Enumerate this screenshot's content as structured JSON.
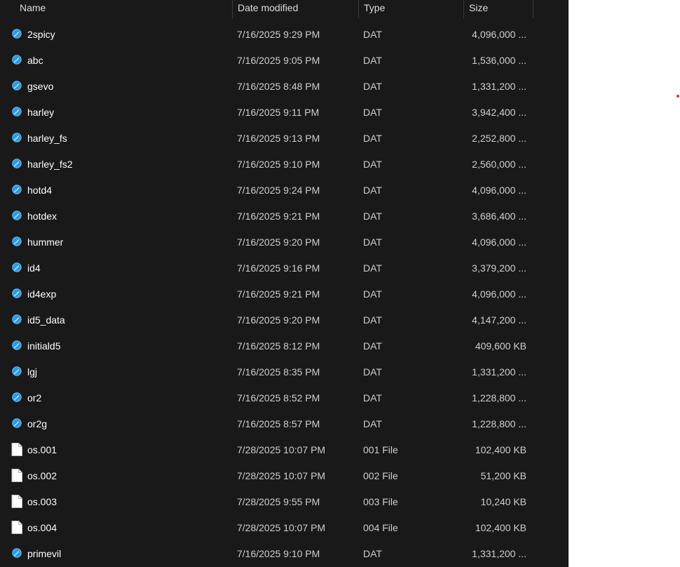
{
  "columns": {
    "name": "Name",
    "date": "Date modified",
    "type": "Type",
    "size": "Size"
  },
  "files": [
    {
      "name": "2spicy",
      "date": "7/16/2025 9:29 PM",
      "type": "DAT",
      "size": "4,096,000 ...",
      "icon": "dat-icon"
    },
    {
      "name": "abc",
      "date": "7/16/2025 9:05 PM",
      "type": "DAT",
      "size": "1,536,000 ...",
      "icon": "dat-icon"
    },
    {
      "name": "gsevo",
      "date": "7/16/2025 8:48 PM",
      "type": "DAT",
      "size": "1,331,200 ...",
      "icon": "dat-icon"
    },
    {
      "name": "harley",
      "date": "7/16/2025 9:11 PM",
      "type": "DAT",
      "size": "3,942,400 ...",
      "icon": "dat-icon"
    },
    {
      "name": "harley_fs",
      "date": "7/16/2025 9:13 PM",
      "type": "DAT",
      "size": "2,252,800 ...",
      "icon": "dat-icon"
    },
    {
      "name": "harley_fs2",
      "date": "7/16/2025 9:10 PM",
      "type": "DAT",
      "size": "2,560,000 ...",
      "icon": "dat-icon"
    },
    {
      "name": "hotd4",
      "date": "7/16/2025 9:24 PM",
      "type": "DAT",
      "size": "4,096,000 ...",
      "icon": "dat-icon"
    },
    {
      "name": "hotdex",
      "date": "7/16/2025 9:21 PM",
      "type": "DAT",
      "size": "3,686,400 ...",
      "icon": "dat-icon"
    },
    {
      "name": "hummer",
      "date": "7/16/2025 9:20 PM",
      "type": "DAT",
      "size": "4,096,000 ...",
      "icon": "dat-icon"
    },
    {
      "name": "id4",
      "date": "7/16/2025 9:16 PM",
      "type": "DAT",
      "size": "3,379,200 ...",
      "icon": "dat-icon"
    },
    {
      "name": "id4exp",
      "date": "7/16/2025 9:21 PM",
      "type": "DAT",
      "size": "4,096,000 ...",
      "icon": "dat-icon"
    },
    {
      "name": "id5_data",
      "date": "7/16/2025 9:20 PM",
      "type": "DAT",
      "size": "4,147,200 ...",
      "icon": "dat-icon"
    },
    {
      "name": "initiald5",
      "date": "7/16/2025 8:12 PM",
      "type": "DAT",
      "size": "409,600 KB",
      "icon": "dat-icon"
    },
    {
      "name": "lgj",
      "date": "7/16/2025 8:35 PM",
      "type": "DAT",
      "size": "1,331,200 ...",
      "icon": "dat-icon"
    },
    {
      "name": "or2",
      "date": "7/16/2025 8:52 PM",
      "type": "DAT",
      "size": "1,228,800 ...",
      "icon": "dat-icon"
    },
    {
      "name": "or2g",
      "date": "7/16/2025 8:57 PM",
      "type": "DAT",
      "size": "1,228,800 ...",
      "icon": "dat-icon"
    },
    {
      "name": "os.001",
      "date": "7/28/2025 10:07 PM",
      "type": "001 File",
      "size": "102,400 KB",
      "icon": "file-icon"
    },
    {
      "name": "os.002",
      "date": "7/28/2025 10:07 PM",
      "type": "002 File",
      "size": "51,200 KB",
      "icon": "file-icon"
    },
    {
      "name": "os.003",
      "date": "7/28/2025 9:55 PM",
      "type": "003 File",
      "size": "10,240 KB",
      "icon": "file-icon"
    },
    {
      "name": "os.004",
      "date": "7/28/2025 10:07 PM",
      "type": "004 File",
      "size": "102,400 KB",
      "icon": "file-icon"
    },
    {
      "name": "primevil",
      "date": "7/16/2025 9:10 PM",
      "type": "DAT",
      "size": "1,331,200 ...",
      "icon": "dat-icon"
    }
  ],
  "colors": {
    "background": "#191919",
    "dat_icon": "#2b9be6",
    "indicator_dot": "#d13438"
  }
}
